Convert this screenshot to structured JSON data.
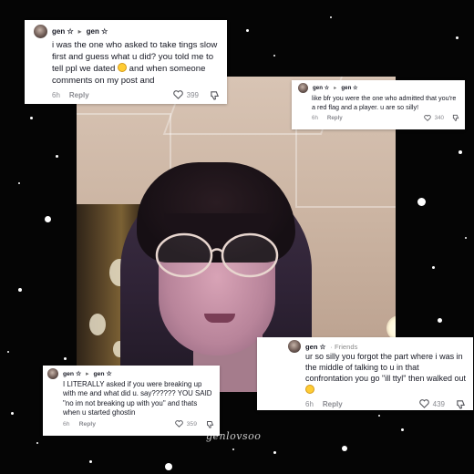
{
  "comments": [
    {
      "username": "gen ☆",
      "reply_to": "gen ☆",
      "friends_tag": "",
      "text": "i was the one who asked to take tings slow first and guess what u did? you told me to tell ppl we dated",
      "text_after_emoji": " and when someone comments on my post and",
      "emoji": "grimacing-face-icon",
      "time": "6h",
      "reply_label": "Reply",
      "likes": "399"
    },
    {
      "username": "gen ☆",
      "reply_to": "gen ☆",
      "friends_tag": "",
      "text": "like bfr you were the one who admitted that you're a red flag and a player. u are so silly!",
      "text_after_emoji": "",
      "emoji": "",
      "time": "6h",
      "reply_label": "Reply",
      "likes": "340"
    },
    {
      "username": "gen ☆",
      "reply_to": "",
      "friends_tag": "· Friends",
      "text": "ur so silly you forgot the part where i was in the middle of talking to u in that confrontation you go \"ill ttyl\" then walked out",
      "text_after_emoji": "",
      "emoji": "grimacing-face-icon",
      "time": "6h",
      "reply_label": "Reply",
      "likes": "439"
    },
    {
      "username": "gen ☆",
      "reply_to": "gen ☆",
      "friends_tag": "",
      "text": "I LITERALLY asked if you were breaking up with me and what did u. say?????? YOU SAID \"no im not breaking up with you\" and thats when u started ghostin",
      "text_after_emoji": "",
      "emoji": "",
      "time": "6h",
      "reply_label": "Reply",
      "likes": "359"
    }
  ],
  "watermark": "genlovsoo",
  "colors": {
    "background": "#050505",
    "card": "#ffffff",
    "text": "#161823",
    "meta": "#8a8b91"
  }
}
